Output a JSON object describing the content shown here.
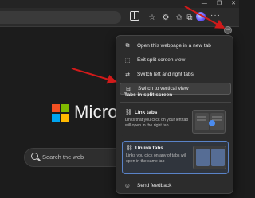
{
  "window": {
    "controls": [
      "—",
      "❐",
      "✕"
    ]
  },
  "toolbar": {
    "icons": [
      "split-screen-icon",
      "favorites-star-icon",
      "settings-gear-icon",
      "collections-icon",
      "profile-avatar",
      "more-icon"
    ],
    "more_label": "···"
  },
  "page": {
    "brand": "Micros",
    "search_placeholder": "Search the web",
    "logo_colors": [
      "#f25022",
      "#7fba00",
      "#00a4ef",
      "#ffb900"
    ]
  },
  "menu": {
    "items": [
      {
        "label": "Open this webpage in a new tab",
        "icon": "open-new-tab-icon"
      },
      {
        "label": "Exit split screen view",
        "icon": "exit-split-icon"
      },
      {
        "label": "Switch left and right tabs",
        "icon": "swap-icon"
      },
      {
        "label": "Switch to vertical view",
        "icon": "vertical-view-icon",
        "selected": true
      }
    ],
    "section_title": "Tabs in split screen",
    "options": [
      {
        "title": "Link tabs",
        "description": "Links that you click on your left tab will open in the right tab",
        "icon": "link-icon"
      },
      {
        "title": "Unlink tabs",
        "description": "Links you click on any of tabs will open in the same tab",
        "icon": "unlink-icon",
        "selected": true
      }
    ],
    "feedback_label": "Send feedback"
  },
  "colors": {
    "accent": "#4b8cf0",
    "arrow": "#d11a1a"
  }
}
